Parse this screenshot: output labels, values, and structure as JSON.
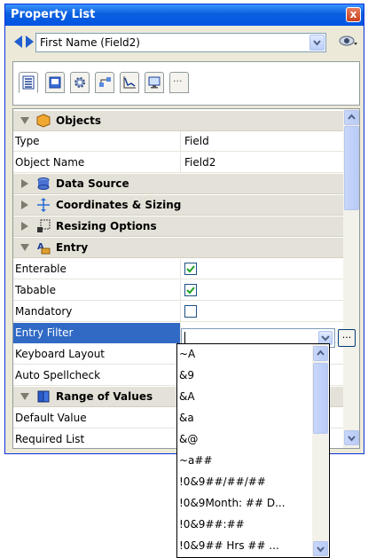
{
  "window": {
    "title": "Property List",
    "close_glyph": "x"
  },
  "record_selector": {
    "value": "First Name (Field2)"
  },
  "tabs": [
    {
      "icon": "list-icon",
      "active": true
    },
    {
      "icon": "form-object-icon",
      "active": false
    },
    {
      "icon": "gear-icon",
      "active": false
    },
    {
      "icon": "hierarchy-icon",
      "active": false
    },
    {
      "icon": "chart-icon",
      "active": false
    },
    {
      "icon": "display-icon",
      "active": false
    },
    {
      "icon": "more-icon",
      "active": false,
      "label": "···"
    }
  ],
  "sections": {
    "objects": "Objects",
    "data_source": "Data Source",
    "coordinates": "Coordinates & Sizing",
    "resizing": "Resizing Options",
    "entry": "Entry",
    "range": "Range of Values"
  },
  "properties": {
    "type": {
      "label": "Type",
      "value": "Field"
    },
    "object_name": {
      "label": "Object Name",
      "value": "Field2"
    },
    "enterable": {
      "label": "Enterable",
      "checked": true
    },
    "tabable": {
      "label": "Tabable",
      "checked": true
    },
    "mandatory": {
      "label": "Mandatory",
      "checked": false
    },
    "entry_filter": {
      "label": "Entry Filter",
      "value": ""
    },
    "keyboard_layout": {
      "label": "Keyboard Layout"
    },
    "auto_spellcheck": {
      "label": "Auto Spellcheck"
    },
    "default_value": {
      "label": "Default Value"
    },
    "required_list": {
      "label": "Required List"
    }
  },
  "entry_filter_button": "...",
  "entry_filter_options": [
    "~A",
    "&9",
    "&A",
    "&a",
    "&@",
    "~a##",
    "!0&9##/##/##",
    "!0&9Month: ## D...",
    "!0&9##:##",
    "!0&9## Hrs ## ..."
  ],
  "colors": {
    "selection": "#316ac5",
    "titlebar": "#0054e3",
    "section_bg": "#e4e2d8"
  }
}
